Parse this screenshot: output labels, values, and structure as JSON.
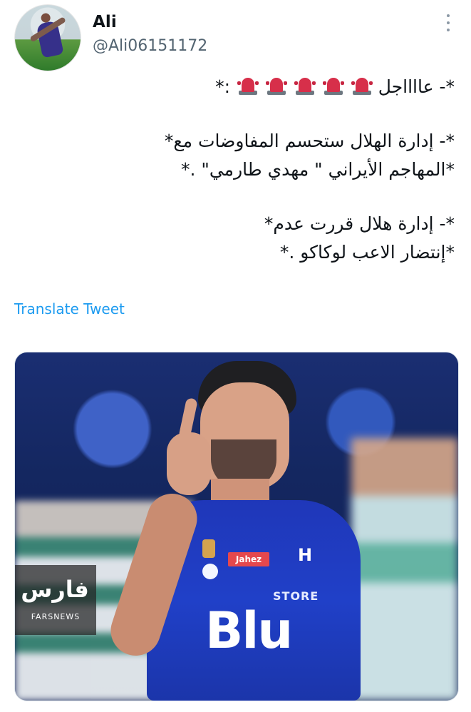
{
  "author": {
    "name": "Ali",
    "handle": "@Ali06151172",
    "avatar": "avatar",
    "more_icon": "more-options-icon"
  },
  "tweet": {
    "line1_start": "*- عااااجل",
    "line1_end": " :*",
    "siren_icon": "police-light-icon",
    "siren_count": 5,
    "line2": "*- إدارة الهلال ستحسم المفاوضات مع*",
    "line3": "*المهاجم الأيراني \" مهدي طارمي\" .*",
    "line4": "*- إدارة هلال قررت عدم*",
    "line5": "*إنتضار الاعب لوكاكو .*"
  },
  "translate": {
    "label": "Translate Tweet"
  },
  "media": {
    "sponsor": "Jahez",
    "crest_text": "H",
    "store_text": "STORE",
    "blu_text": "Blu",
    "watermark_logo": "فارس",
    "watermark_sub": "FARSNEWS"
  },
  "colors": {
    "accent_blue": "#1d9bf0",
    "text_primary": "#0f1419",
    "text_secondary": "#536471",
    "siren_red": "#d72f4a"
  }
}
